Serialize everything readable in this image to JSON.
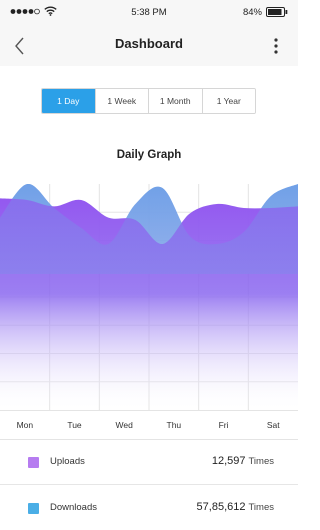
{
  "status": {
    "time": "5:38 PM",
    "battery": "84%"
  },
  "header": {
    "title": "Dashboard"
  },
  "tabs": [
    {
      "label": "1 Day",
      "active": true
    },
    {
      "label": "1 Week",
      "active": false
    },
    {
      "label": "1 Month",
      "active": false
    },
    {
      "label": "1 Year",
      "active": false
    }
  ],
  "graph": {
    "title": "Daily Graph"
  },
  "chart_data": {
    "type": "area",
    "title": "Daily Graph",
    "categories": [
      "Mon",
      "Tue",
      "Wed",
      "Thu",
      "Fri",
      "Sat"
    ],
    "series": [
      {
        "name": "Uploads",
        "color": "#a06cf2",
        "values": [
          0.82,
          0.8,
          0.72,
          0.8,
          0.58,
          0.55,
          0.25,
          0.63,
          0.75,
          0.7,
          0.7,
          0.72
        ]
      },
      {
        "name": "Downloads",
        "color": "#6fa3e6",
        "values": [
          0.58,
          1.0,
          0.7,
          0.45,
          0.25,
          0.75,
          0.95,
          0.35,
          0.25,
          0.4,
          0.85,
          1.0
        ]
      }
    ],
    "grid": true
  },
  "legend": [
    {
      "name": "Uploads",
      "value": "12,597",
      "unit": "Times",
      "color": "#b67cf0"
    },
    {
      "name": "Downloads",
      "value": "57,85,612",
      "unit": "Times",
      "color": "#4aaee6"
    }
  ]
}
